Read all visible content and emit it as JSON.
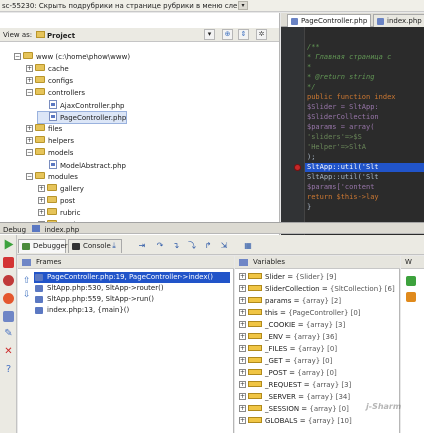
{
  "window": {
    "title": "sc-55230: Скрыть подрубрики на странице рубрики в меню слева",
    "dropdown_icon": "chevron-down-icon"
  },
  "project": {
    "view_as_label": "View as:",
    "view_value": "Project",
    "tree": [
      {
        "label": "www (c:\\home\\phow\\www)",
        "depth": 0,
        "type": "folder",
        "expanded": true
      },
      {
        "label": "cache",
        "depth": 1,
        "type": "folder",
        "expanded": false
      },
      {
        "label": "configs",
        "depth": 1,
        "type": "folder",
        "expanded": false
      },
      {
        "label": "controllers",
        "depth": 1,
        "type": "folder",
        "expanded": true
      },
      {
        "label": "AjaxController.php",
        "depth": 2,
        "type": "file"
      },
      {
        "label": "PageController.php",
        "depth": 2,
        "type": "file",
        "selected": true
      },
      {
        "label": "files",
        "depth": 1,
        "type": "folder",
        "expanded": false
      },
      {
        "label": "helpers",
        "depth": 1,
        "type": "folder",
        "expanded": false
      },
      {
        "label": "models",
        "depth": 1,
        "type": "folder",
        "expanded": true
      },
      {
        "label": "ModelAbstract.php",
        "depth": 2,
        "type": "file"
      },
      {
        "label": "modules",
        "depth": 1,
        "type": "folder",
        "expanded": true
      },
      {
        "label": "gallery",
        "depth": 2,
        "type": "folder",
        "expanded": false
      },
      {
        "label": "post",
        "depth": 2,
        "type": "folder",
        "expanded": false
      },
      {
        "label": "rubric",
        "depth": 2,
        "type": "folder",
        "expanded": false
      },
      {
        "label": "setting",
        "depth": 2,
        "type": "folder",
        "expanded": false
      }
    ]
  },
  "editor": {
    "tabs": [
      {
        "label": "PageController.php",
        "active": true
      },
      {
        "label": "index.php",
        "active": false
      }
    ],
    "lines": [
      {
        "text": "/**",
        "cls": "c-cm"
      },
      {
        "text": " * Главная страница с",
        "cls": "c-cm"
      },
      {
        "text": " *",
        "cls": "c-cm"
      },
      {
        "text": " * @return string",
        "cls": "c-cm"
      },
      {
        "text": " */",
        "cls": "c-cm"
      },
      {
        "text": "public function index",
        "cls": "c-kw"
      },
      {
        "text": "    $Slider = SltApp:",
        "cls": "c-var"
      },
      {
        "text": "    $SliderCollection",
        "cls": "c-var"
      },
      {
        "text": "    $params = array(",
        "cls": "c-var"
      },
      {
        "text": "        'sliders'=>$S",
        "cls": "c-str"
      },
      {
        "text": "        'Helper'=>SltA",
        "cls": "c-str"
      },
      {
        "text": "    );",
        "cls": "c-pl"
      },
      {
        "text": "    SltApp::util('Slt",
        "cls": "c-pl",
        "breakpoint": true
      },
      {
        "text": "    SltApp::util('Slt",
        "cls": "c-pl"
      },
      {
        "text": "    $params['content",
        "cls": "c-var"
      },
      {
        "text": "    return $this->lay",
        "cls": "c-kw"
      },
      {
        "text": "}",
        "cls": "c-pl"
      }
    ]
  },
  "debug": {
    "header": "Debug",
    "config_name": "index.php",
    "tabs": [
      {
        "label": "Debugger",
        "active": true
      },
      {
        "label": "Console",
        "active": false
      }
    ],
    "frames_title": "Frames",
    "frames": [
      {
        "label": "PageController.php:19, PageController->index()",
        "selected": true
      },
      {
        "label": "SltApp.php:530, SltApp->router()",
        "selected": false
      },
      {
        "label": "SltApp.php:559, SltApp->run()",
        "selected": false
      },
      {
        "label": "index.php:13, {main}()",
        "selected": false
      }
    ],
    "variables_title": "Variables",
    "watches_title": "W",
    "variables": [
      {
        "name": "Slider",
        "value": "{Slider} [9]"
      },
      {
        "name": "SliderCollection",
        "value": "{SltCollection} [6]"
      },
      {
        "name": "params",
        "value": "{array} [2]"
      },
      {
        "name": "this",
        "value": "{PageController} [0]"
      },
      {
        "name": "_COOKIE",
        "value": "{array} [3]"
      },
      {
        "name": "_ENV",
        "value": "{array} [36]"
      },
      {
        "name": "_FILES",
        "value": "{array} [0]"
      },
      {
        "name": "_GET",
        "value": "{array} [0]"
      },
      {
        "name": "_POST",
        "value": "{array} [0]"
      },
      {
        "name": "_REQUEST",
        "value": "{array} [3]"
      },
      {
        "name": "_SERVER",
        "value": "{array} [34]"
      },
      {
        "name": "_SESSION",
        "value": "{array} [0]"
      },
      {
        "name": "GLOBALS",
        "value": "{array} [10]"
      }
    ],
    "watermark": "j-Sharm"
  }
}
